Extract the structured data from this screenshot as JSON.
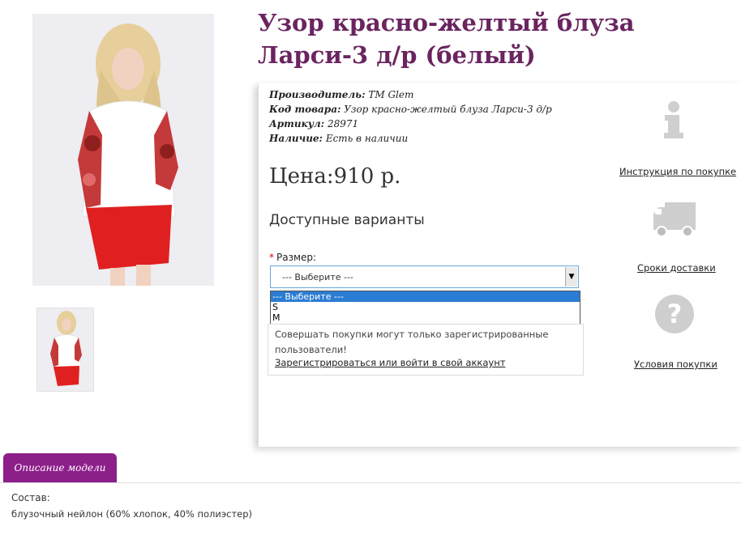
{
  "product": {
    "title": "Узор красно-желтый блуза Ларси-3 д/р (белый)",
    "manufacturer_label": "Производитель:",
    "manufacturer": "ТМ Glem",
    "code_label": "Код товара:",
    "code": "Узор красно-желтый блуза Ларси-3 д/р",
    "sku_label": "Артикул:",
    "sku": "28971",
    "availability_label": "Наличие:",
    "availability": "Есть в наличии",
    "price": "Цена:910 р."
  },
  "options": {
    "heading": "Доступные варианты",
    "size_required_mark": "*",
    "size_label": "Размер:",
    "size_selected": "--- Выберите ---",
    "size_options": [
      "--- Выберите ---",
      "S",
      "M"
    ]
  },
  "notice": {
    "text": "Совершать покупки могут только зарегистрированные пользователи!",
    "link": "Зарегистрироваться или войти в свой аккаунт"
  },
  "side": {
    "instruction_link": "Инструкция по покупке",
    "delivery_link": "Сроки доставки",
    "terms_link": "Условия покупки",
    "icons": [
      "info-icon",
      "truck-icon",
      "question-icon"
    ],
    "icon_color": "#cfcfcf"
  },
  "tabs": {
    "description": "Описание модели"
  },
  "description": {
    "label": "Состав:",
    "text": "блузочный нейлон (60% хлопок, 40% полиэстер)"
  },
  "colors": {
    "title": "#6a2460",
    "tab": "#8d1f8a",
    "select_highlight": "#2b7cd3"
  }
}
